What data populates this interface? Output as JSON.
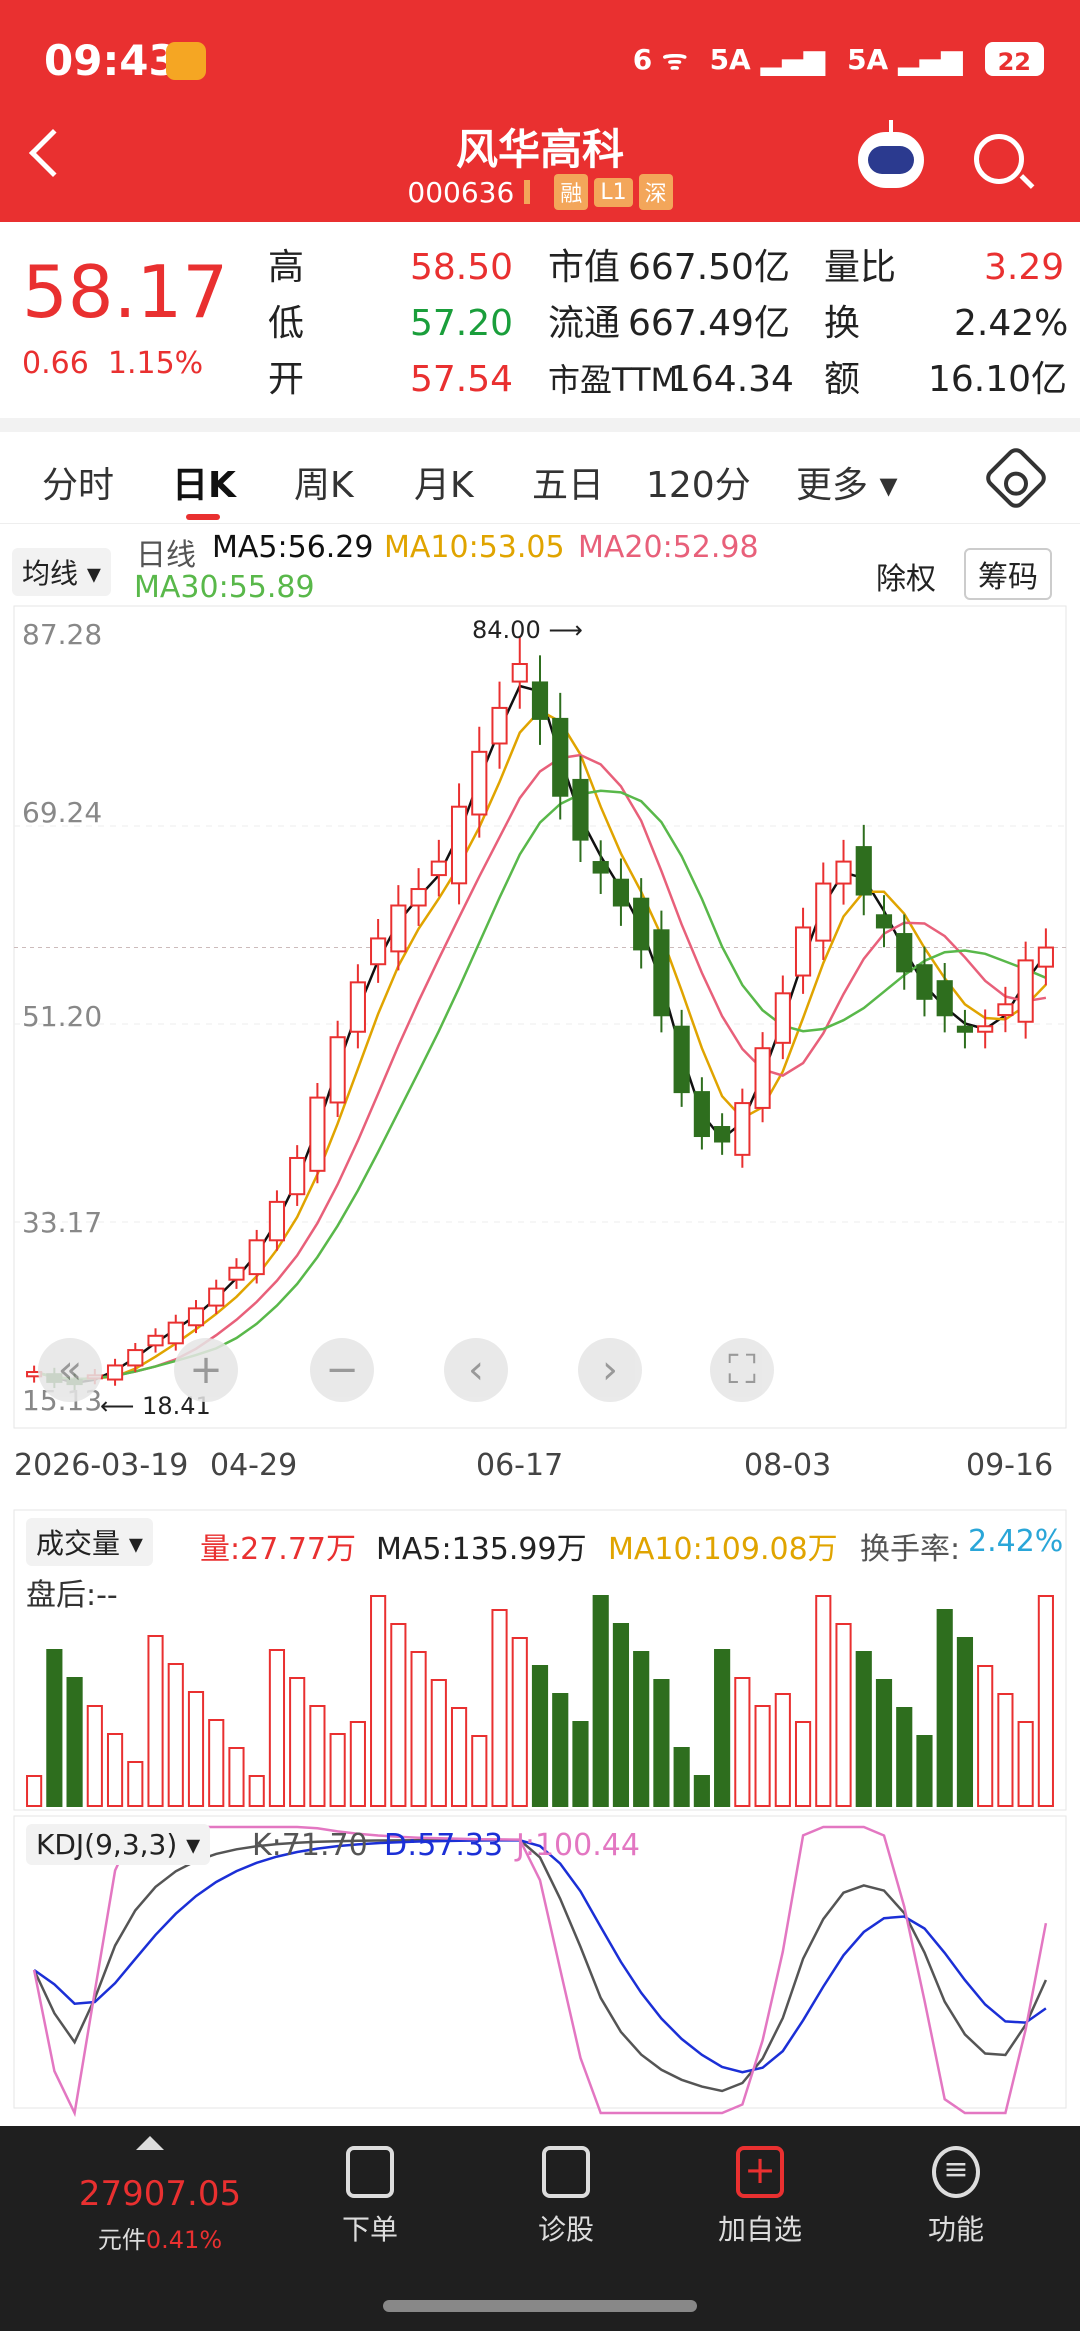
{
  "status": {
    "time": "09:43",
    "battery": "22",
    "net1": "6",
    "net2": "5A",
    "net3": "5A"
  },
  "header": {
    "title": "风华高科",
    "code": "000636",
    "tags": [
      "融",
      "L1",
      "深"
    ]
  },
  "quote": {
    "price": "58.17",
    "change": "0.66",
    "change_pct": "1.15%",
    "rows": [
      [
        {
          "k": "高",
          "v": "58.50",
          "c": "red"
        },
        {
          "k": "市值",
          "v": "667.50亿"
        },
        {
          "k": "量比",
          "v": "3.29",
          "c": "red"
        }
      ],
      [
        {
          "k": "低",
          "v": "57.20",
          "c": "green"
        },
        {
          "k": "流通",
          "v": "667.49亿"
        },
        {
          "k": "换",
          "v": "2.42%"
        }
      ],
      [
        {
          "k": "开",
          "v": "57.54",
          "c": "red"
        },
        {
          "k": "市盈TTM",
          "v": "164.34"
        },
        {
          "k": "额",
          "v": "16.10亿"
        }
      ]
    ]
  },
  "tabs": [
    "分时",
    "日K",
    "周K",
    "月K",
    "五日",
    "120分",
    "更多"
  ],
  "active_tab": 1,
  "kline": {
    "ma_toggle": "均线",
    "period": "日线",
    "ma5": "MA5:56.29",
    "ma10": "MA10:53.05",
    "ma20": "MA20:52.98",
    "ma30": "MA30:55.89",
    "fq": "除权",
    "chip": "筹码",
    "y_ticks": [
      "87.28",
      "69.24",
      "51.20",
      "33.17",
      "15.13"
    ],
    "high_mark": "84.00",
    "low_mark": "18.41",
    "x_ticks": [
      "2026-03-19",
      "04-29",
      "06-17",
      "08-03",
      "09-16"
    ]
  },
  "volume": {
    "selector": "成交量",
    "vol": "量:27.77万",
    "ma5": "MA5:135.99万",
    "ma10": "MA10:109.08万",
    "turn_label": "换手率:",
    "turn": "2.42%",
    "after_hours": "盘后:--"
  },
  "kdj": {
    "selector": "KDJ(9,3,3)",
    "k": "K:71.70",
    "d": "D:57.33",
    "j": "J:100.44"
  },
  "colors": {
    "up": "#e93030",
    "down": "#2e6e1e",
    "ma5": "#111111",
    "ma10": "#e0a400",
    "ma20": "#e8607a",
    "ma30": "#59b84a",
    "kdj_k": "#555555",
    "kdj_d": "#1b2fd6",
    "kdj_j": "#e377c2"
  },
  "bottom_nav": {
    "index_value": "27907.05",
    "index_label": "元件",
    "index_pct": "0.41%",
    "items": [
      "下单",
      "诊股",
      "加自选",
      "功能"
    ]
  },
  "chart_data": {
    "type": "candlestick",
    "title": "风华高科 日K",
    "x": [
      "2026-03-19",
      "04-29",
      "06-17",
      "08-03",
      "09-16"
    ],
    "ylim": [
      15.13,
      87.28
    ],
    "close_path": [
      19.5,
      18.6,
      18.4,
      19.2,
      20.1,
      21.5,
      22.8,
      24.0,
      25.3,
      27.1,
      29.0,
      31.5,
      35.0,
      39.0,
      44.5,
      50.0,
      55.0,
      59.0,
      62.0,
      63.5,
      66.0,
      71.0,
      76.0,
      80.0,
      84.0,
      79.0,
      72.0,
      68.0,
      65.0,
      62.0,
      58.0,
      52.0,
      45.0,
      41.0,
      40.5,
      44.0,
      49.0,
      54.0,
      60.0,
      64.0,
      66.0,
      63.0,
      60.0,
      56.0,
      53.5,
      52.0,
      50.5,
      51.0,
      53.0,
      57.0,
      58.17
    ],
    "kdj": {
      "K": 71.7,
      "D": 57.33,
      "J": 100.44
    }
  }
}
